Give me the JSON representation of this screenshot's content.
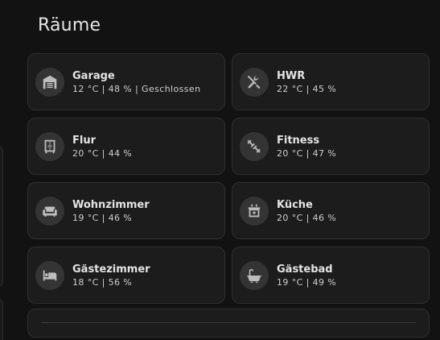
{
  "section": {
    "title": "Räume"
  },
  "rooms": [
    {
      "name": "Garage",
      "state": "12 °C | 48 % | Geschlossen",
      "icon": "garage-icon"
    },
    {
      "name": "HWR",
      "state": "22 °C | 45 %",
      "icon": "tools-icon"
    },
    {
      "name": "Flur",
      "state": "20 °C | 44 %",
      "icon": "wardrobe-icon"
    },
    {
      "name": "Fitness",
      "state": "20 °C | 47 %",
      "icon": "dumbbell-icon"
    },
    {
      "name": "Wohnzimmer",
      "state": "19 °C | 46 %",
      "icon": "sofa-icon"
    },
    {
      "name": "Küche",
      "state": "20 °C | 46 %",
      "icon": "stove-icon"
    },
    {
      "name": "Gästezimmer",
      "state": "18 °C | 56 %",
      "icon": "bed-icon"
    },
    {
      "name": "Gästebad",
      "state": "19 °C | 49 %",
      "icon": "bathtub-icon"
    }
  ],
  "colors": {
    "background": "#121212",
    "card": "#1c1c1c",
    "icon_bg": "#343434",
    "icon": "#bdbdbd"
  }
}
